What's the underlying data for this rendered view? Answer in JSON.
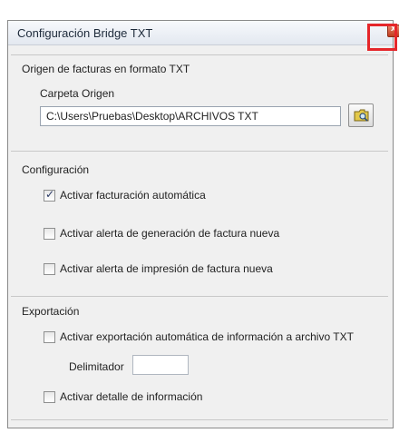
{
  "window": {
    "title": "Configuración Bridge TXT"
  },
  "origin": {
    "group_title": "Origen de facturas en formato TXT",
    "folder_label": "Carpeta Origen",
    "folder_path": "C:\\Users\\Pruebas\\Desktop\\ARCHIVOS TXT",
    "browse_icon": "folder-browse-icon"
  },
  "config": {
    "group_title": "Configuración",
    "options": [
      {
        "label": "Activar facturación automática",
        "checked": true
      },
      {
        "label": "Activar alerta de generación de factura nueva",
        "checked": false
      },
      {
        "label": "Activar alerta de impresión de factura nueva",
        "checked": false
      }
    ]
  },
  "export": {
    "group_title": "Exportación",
    "auto_export_label": "Activar exportación automática de información a archivo TXT",
    "auto_export_checked": false,
    "delimiter_label": "Delimitador",
    "delimiter_value": "",
    "detail_label": "Activar detalle de información",
    "detail_checked": false
  },
  "colors": {
    "highlight": "#e5262a",
    "close_button": "#c03d1e"
  }
}
